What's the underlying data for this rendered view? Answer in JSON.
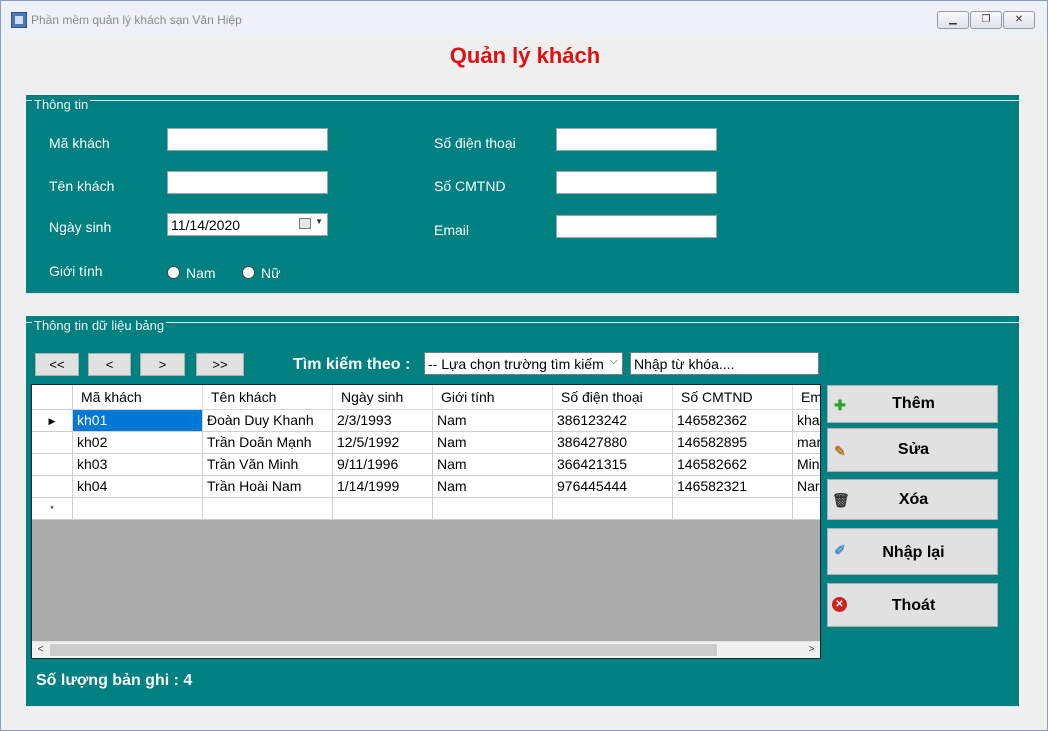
{
  "window": {
    "title": "Phần mềm quản lý khách sạn Văn Hiệp",
    "minimize": "▁",
    "restore": "❐",
    "close": "✕"
  },
  "page_title": "Quản lý khách",
  "info": {
    "legend": "Thông tin",
    "ma_khach_label": "Mã khách",
    "ten_khach_label": "Tên khách",
    "ngay_sinh_label": "Ngày sinh",
    "ngay_sinh_value": "11/14/2020",
    "gioi_tinh_label": "Giới tính",
    "nam_label": "Nam",
    "nu_label": "Nữ",
    "sdt_label": "Số điện thoại",
    "cmtnd_label": "Số CMTND",
    "email_label": "Email"
  },
  "data_group": {
    "legend": "Thông tin dữ liệu  bảng",
    "nav": [
      "<<",
      "<",
      ">",
      ">>"
    ],
    "search_label": "Tìm kiếm theo :",
    "search_field": "-- Lựa chọn trường tìm kiếm",
    "keyword": "Nhập từ khóa....",
    "count_label": "Số lượng bản ghi : 4"
  },
  "table": {
    "columns": [
      "Mã khách",
      "Tên khách",
      "Ngày sinh",
      "Giới tính",
      "Số điện thoại",
      "Số CMTND",
      "Em"
    ],
    "rows": [
      [
        "kh01",
        "Đoàn Duy Khanh",
        "2/3/1993",
        "Nam",
        "386123242",
        "146582362",
        "kha"
      ],
      [
        "kh02",
        "Trần Doãn Mạnh",
        "12/5/1992",
        "Nam",
        "386427880",
        "146582895",
        "mar"
      ],
      [
        "kh03",
        "Trần Văn Minh",
        "9/11/1996",
        "Nam",
        "366421315",
        "146582662",
        "Min"
      ],
      [
        "kh04",
        "Trần Hoài Nam",
        "1/14/1999",
        "Nam",
        "976445444",
        "146582321",
        "Nar"
      ]
    ],
    "current_row_marker": "▶",
    "new_row_marker": "*"
  },
  "actions": {
    "them": "Thêm",
    "sua": "Sửa",
    "xoa": "Xóa",
    "nhap_lai": "Nhập lại",
    "thoat": "Thoát"
  },
  "colors": {
    "panel": "#008080",
    "title": "#e01010",
    "selection": "#0078d7"
  }
}
